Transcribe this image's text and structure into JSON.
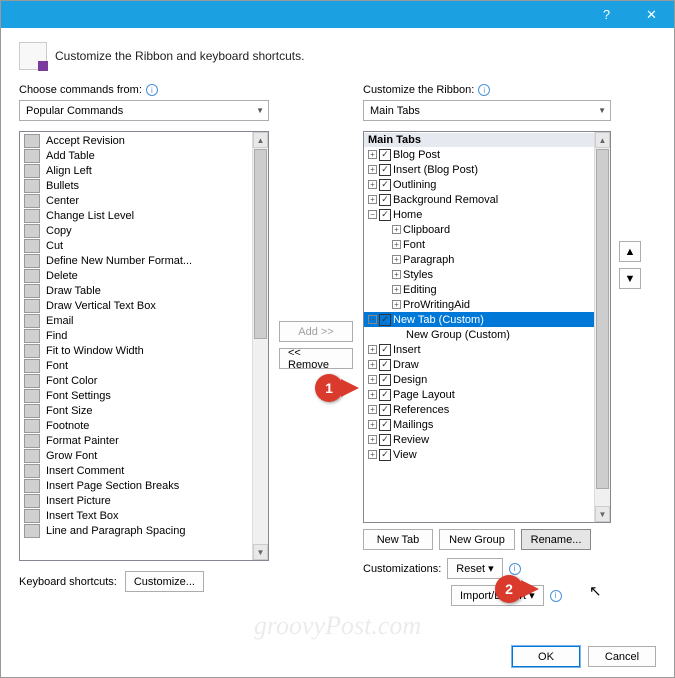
{
  "titlebar": {
    "help": "?",
    "close": "✕"
  },
  "header": {
    "text": "Customize the Ribbon and keyboard shortcuts."
  },
  "left": {
    "label": "Choose commands from:",
    "dropdown": "Popular Commands",
    "items": [
      "Accept Revision",
      "Add Table",
      "Align Left",
      "Bullets",
      "Center",
      "Change List Level",
      "Copy",
      "Cut",
      "Define New Number Format...",
      "Delete",
      "Draw Table",
      "Draw Vertical Text Box",
      "Email",
      "Find",
      "Fit to Window Width",
      "Font",
      "Font Color",
      "Font Settings",
      "Font Size",
      "Footnote",
      "Format Painter",
      "Grow Font",
      "Insert Comment",
      "Insert Page  Section Breaks",
      "Insert Picture",
      "Insert Text Box",
      "Line and Paragraph Spacing"
    ]
  },
  "mid": {
    "add": "Add >>",
    "remove": "<< Remove"
  },
  "right": {
    "label": "Customize the Ribbon:",
    "dropdown": "Main Tabs",
    "header": "Main Tabs",
    "tabs_top": [
      "Blog Post",
      "Insert (Blog Post)",
      "Outlining",
      "Background Removal"
    ],
    "home": "Home",
    "home_groups": [
      "Clipboard",
      "Font",
      "Paragraph",
      "Styles",
      "Editing",
      "ProWritingAid"
    ],
    "custom_tab": "New Tab (Custom)",
    "custom_group": "New Group (Custom)",
    "tabs_bottom": [
      "Insert",
      "Draw",
      "Design",
      "Page Layout",
      "References",
      "Mailings",
      "Review",
      "View"
    ],
    "newtab": "New Tab",
    "newgroup": "New Group",
    "rename": "Rename...",
    "customizations": "Customizations:",
    "reset": "Reset",
    "importexport": "Import/Export"
  },
  "arrows": {
    "up": "▲",
    "down": "▼"
  },
  "kbd": {
    "label": "Keyboard shortcuts:",
    "btn": "Customize..."
  },
  "footer": {
    "ok": "OK",
    "cancel": "Cancel"
  },
  "callouts": {
    "one": "1",
    "two": "2"
  },
  "watermark": "groovyPost.com"
}
